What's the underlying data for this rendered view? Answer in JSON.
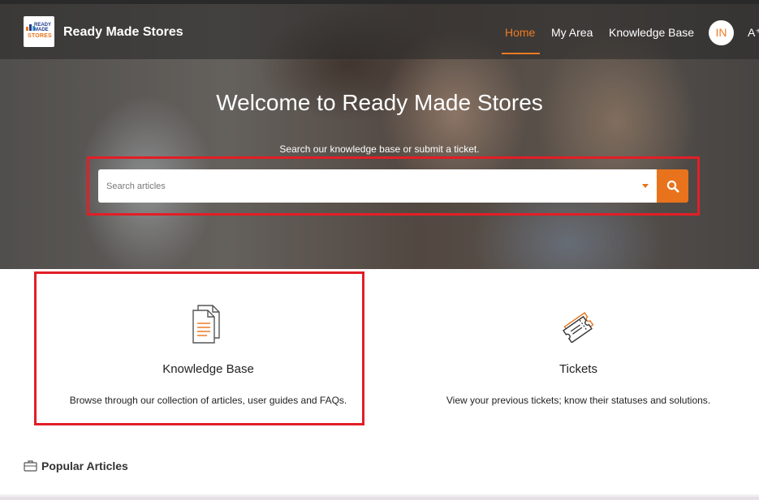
{
  "header": {
    "brand": "Ready Made Stores",
    "logo_text_top": "READY MADE",
    "logo_text_bottom": "STORES",
    "nav": [
      {
        "label": "Home",
        "active": true
      },
      {
        "label": "My Area",
        "active": false
      },
      {
        "label": "Knowledge Base",
        "active": false
      }
    ],
    "avatar_initials": "IN",
    "text_size_glyph": "A⁺",
    "accent_color": "#f07b23"
  },
  "hero": {
    "title": "Welcome to Ready Made Stores",
    "subtitle": "Search our knowledge base or submit a ticket.",
    "search_placeholder": "Search articles",
    "search_icon": "search-icon",
    "dropdown_icon": "caret-down-icon"
  },
  "cards": [
    {
      "title": "Knowledge Base",
      "description": "Browse through our collection of articles, user guides and FAQs.",
      "icon": "documents-icon"
    },
    {
      "title": "Tickets",
      "description": "View your previous tickets; know their statuses and solutions.",
      "icon": "ticket-icon"
    }
  ],
  "popular": {
    "title": "Popular Articles",
    "icon": "briefcase-icon"
  }
}
